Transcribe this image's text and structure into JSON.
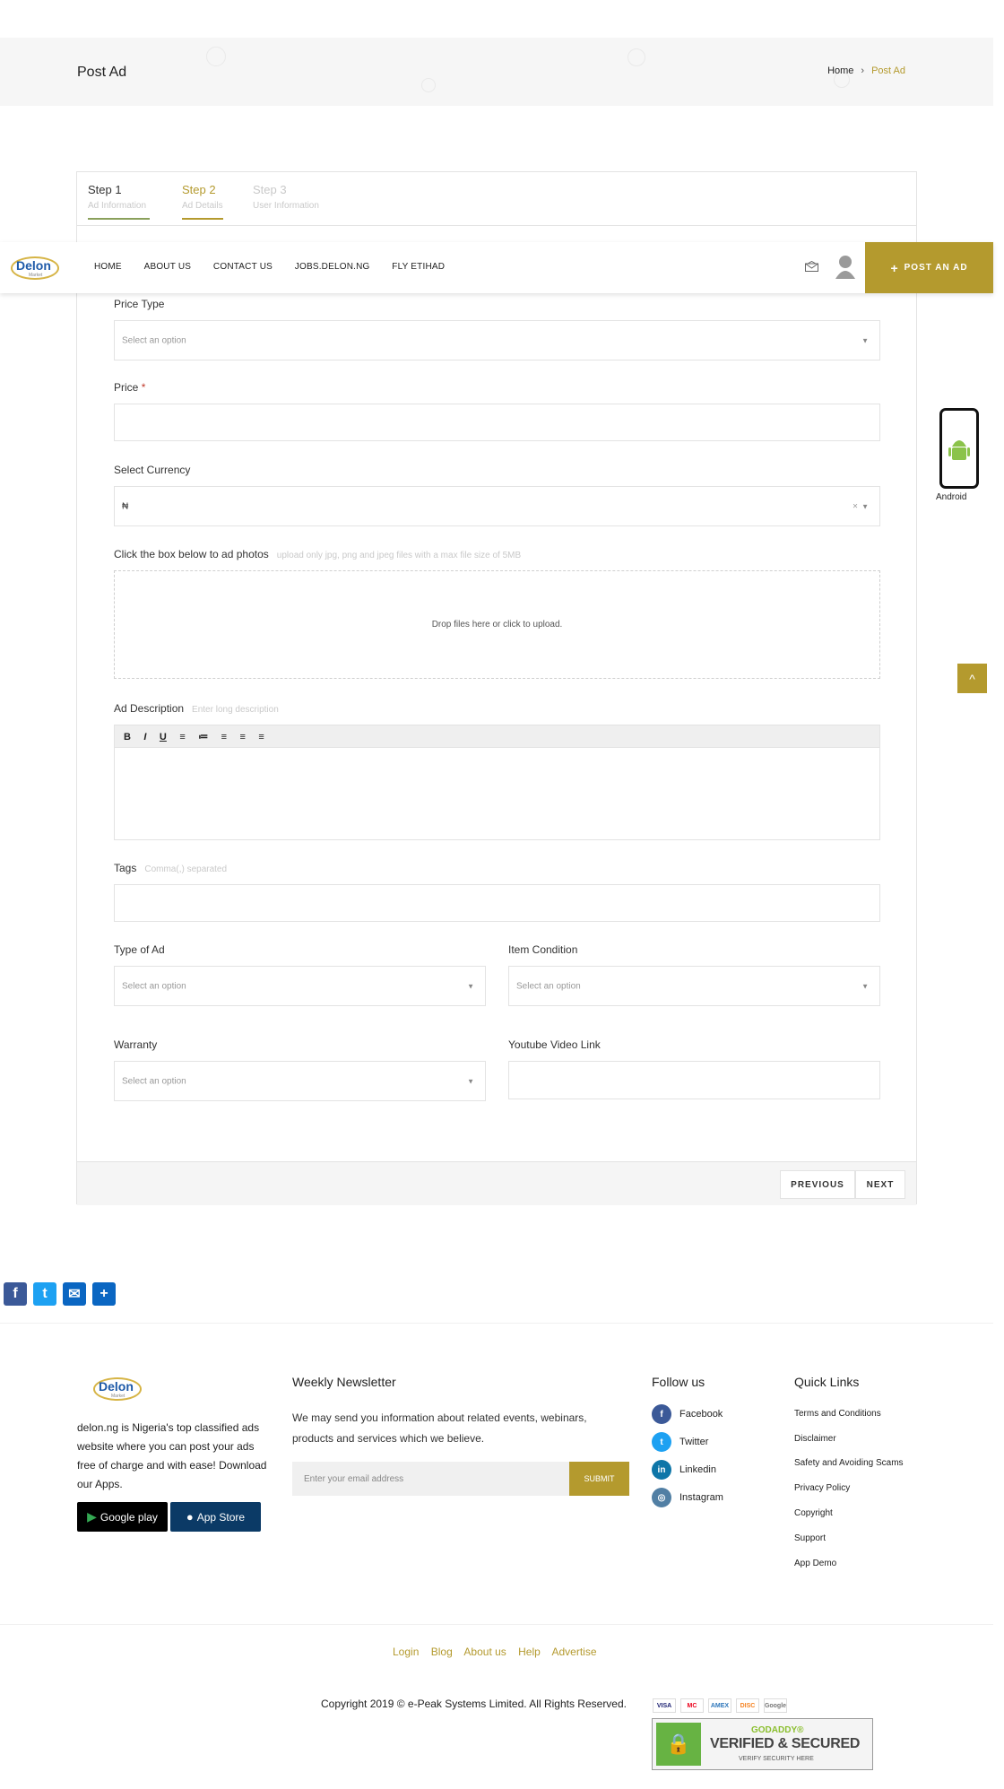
{
  "banner": {
    "title": "Post Ad",
    "breadcrumb": {
      "home": "Home",
      "separator": "›",
      "current": "Post Ad"
    }
  },
  "steps": [
    {
      "label": "Step 1",
      "sub": "Ad Information"
    },
    {
      "label": "Step 2",
      "sub": "Ad Details"
    },
    {
      "label": "Step 3",
      "sub": "User Information"
    }
  ],
  "navbar": {
    "logo": "Delon",
    "logo_sub": "Market",
    "links": [
      "HOME",
      "ABOUT US",
      "CONTACT US",
      "JOBS.DELON.NG",
      "FLY ETIHAD"
    ],
    "post_ad": "POST AN AD"
  },
  "form": {
    "price_type": {
      "label": "Price Type",
      "placeholder": "Select an option"
    },
    "price": {
      "label": "Price",
      "required": "*",
      "value": ""
    },
    "currency": {
      "label": "Select Currency",
      "value": "₦",
      "clear": "×"
    },
    "photos": {
      "label": "Click the box below to ad photos",
      "hint": "upload only jpg, png and jpeg files with a max file size of 5MB",
      "dropzone": "Drop files here or click to upload."
    },
    "description": {
      "label": "Ad Description",
      "hint": "Enter long description",
      "toolbar": [
        "B",
        "I",
        "U",
        "≡",
        "≔",
        "≡",
        "≡",
        "≡"
      ]
    },
    "tags": {
      "label": "Tags",
      "hint": "Comma(,) separated"
    },
    "type_of_ad": {
      "label": "Type of Ad",
      "placeholder": "Select an option"
    },
    "item_condition": {
      "label": "Item Condition",
      "placeholder": "Select an option"
    },
    "warranty": {
      "label": "Warranty",
      "placeholder": "Select an option"
    },
    "youtube": {
      "label": "Youtube Video Link",
      "value": ""
    },
    "previous": "PREVIOUS",
    "next": "NEXT"
  },
  "side": {
    "android_label": "Android",
    "to_top": "^"
  },
  "footer": {
    "about": "delon.ng is Nigeria's top classified ads website where you can post your ads free of charge and with ease! Download our Apps.",
    "google_play": "Google play",
    "app_store": "App Store",
    "newsletter": {
      "title": "Weekly Newsletter",
      "text": "We may send you information about related events, webinars, products and services which we believe.",
      "placeholder": "Enter your email address",
      "submit": "SUBMIT"
    },
    "follow": {
      "title": "Follow us",
      "items": [
        "Facebook",
        "Twitter",
        "Linkedin",
        "Instagram"
      ]
    },
    "quick_links": {
      "title": "Quick Links",
      "items": [
        "Terms and Conditions",
        "Disclaimer",
        "Safety and Avoiding Scams",
        "Privacy Policy",
        "Copyright",
        "Support",
        "App Demo"
      ]
    },
    "bottom_links": [
      "Login",
      "Blog",
      "About us",
      "Help",
      "Advertise"
    ],
    "copyright": "Copyright 2019 © e-Peak Systems Limited.  All Rights Reserved.",
    "cards": [
      "VISA",
      "MC",
      "AMEX",
      "DISC",
      "Google"
    ],
    "godaddy": {
      "brand": "GODADDY®",
      "main": "VERIFIED & SECURED",
      "sub": "VERIFY SECURITY HERE"
    }
  },
  "colors": {
    "accent": "#b49a2e",
    "facebook": "#3b5998",
    "twitter": "#1da1f2",
    "linkedin": "#0e76a8",
    "instagram": "#517fa4"
  }
}
